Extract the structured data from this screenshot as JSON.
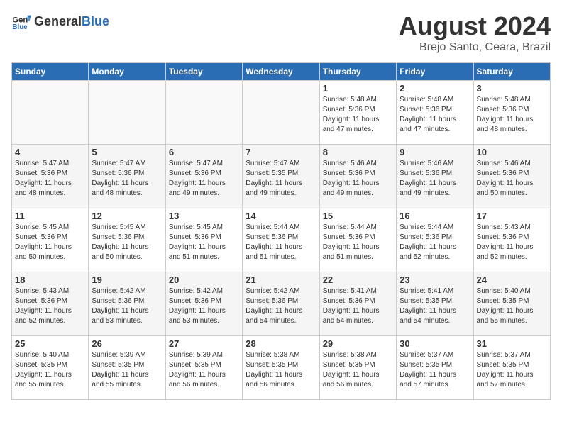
{
  "header": {
    "logo_general": "General",
    "logo_blue": "Blue",
    "month": "August 2024",
    "location": "Brejo Santo, Ceara, Brazil"
  },
  "calendar": {
    "days_of_week": [
      "Sunday",
      "Monday",
      "Tuesday",
      "Wednesday",
      "Thursday",
      "Friday",
      "Saturday"
    ],
    "weeks": [
      {
        "rowClass": "row-odd",
        "days": [
          {
            "num": "",
            "info": "",
            "empty": true
          },
          {
            "num": "",
            "info": "",
            "empty": true
          },
          {
            "num": "",
            "info": "",
            "empty": true
          },
          {
            "num": "",
            "info": "",
            "empty": true
          },
          {
            "num": "1",
            "info": "Sunrise: 5:48 AM\nSunset: 5:36 PM\nDaylight: 11 hours\nand 47 minutes.",
            "empty": false
          },
          {
            "num": "2",
            "info": "Sunrise: 5:48 AM\nSunset: 5:36 PM\nDaylight: 11 hours\nand 47 minutes.",
            "empty": false
          },
          {
            "num": "3",
            "info": "Sunrise: 5:48 AM\nSunset: 5:36 PM\nDaylight: 11 hours\nand 48 minutes.",
            "empty": false
          }
        ]
      },
      {
        "rowClass": "row-even",
        "days": [
          {
            "num": "4",
            "info": "Sunrise: 5:47 AM\nSunset: 5:36 PM\nDaylight: 11 hours\nand 48 minutes.",
            "empty": false
          },
          {
            "num": "5",
            "info": "Sunrise: 5:47 AM\nSunset: 5:36 PM\nDaylight: 11 hours\nand 48 minutes.",
            "empty": false
          },
          {
            "num": "6",
            "info": "Sunrise: 5:47 AM\nSunset: 5:36 PM\nDaylight: 11 hours\nand 49 minutes.",
            "empty": false
          },
          {
            "num": "7",
            "info": "Sunrise: 5:47 AM\nSunset: 5:35 PM\nDaylight: 11 hours\nand 49 minutes.",
            "empty": false
          },
          {
            "num": "8",
            "info": "Sunrise: 5:46 AM\nSunset: 5:36 PM\nDaylight: 11 hours\nand 49 minutes.",
            "empty": false
          },
          {
            "num": "9",
            "info": "Sunrise: 5:46 AM\nSunset: 5:36 PM\nDaylight: 11 hours\nand 49 minutes.",
            "empty": false
          },
          {
            "num": "10",
            "info": "Sunrise: 5:46 AM\nSunset: 5:36 PM\nDaylight: 11 hours\nand 50 minutes.",
            "empty": false
          }
        ]
      },
      {
        "rowClass": "row-odd",
        "days": [
          {
            "num": "11",
            "info": "Sunrise: 5:45 AM\nSunset: 5:36 PM\nDaylight: 11 hours\nand 50 minutes.",
            "empty": false
          },
          {
            "num": "12",
            "info": "Sunrise: 5:45 AM\nSunset: 5:36 PM\nDaylight: 11 hours\nand 50 minutes.",
            "empty": false
          },
          {
            "num": "13",
            "info": "Sunrise: 5:45 AM\nSunset: 5:36 PM\nDaylight: 11 hours\nand 51 minutes.",
            "empty": false
          },
          {
            "num": "14",
            "info": "Sunrise: 5:44 AM\nSunset: 5:36 PM\nDaylight: 11 hours\nand 51 minutes.",
            "empty": false
          },
          {
            "num": "15",
            "info": "Sunrise: 5:44 AM\nSunset: 5:36 PM\nDaylight: 11 hours\nand 51 minutes.",
            "empty": false
          },
          {
            "num": "16",
            "info": "Sunrise: 5:44 AM\nSunset: 5:36 PM\nDaylight: 11 hours\nand 52 minutes.",
            "empty": false
          },
          {
            "num": "17",
            "info": "Sunrise: 5:43 AM\nSunset: 5:36 PM\nDaylight: 11 hours\nand 52 minutes.",
            "empty": false
          }
        ]
      },
      {
        "rowClass": "row-even",
        "days": [
          {
            "num": "18",
            "info": "Sunrise: 5:43 AM\nSunset: 5:36 PM\nDaylight: 11 hours\nand 52 minutes.",
            "empty": false
          },
          {
            "num": "19",
            "info": "Sunrise: 5:42 AM\nSunset: 5:36 PM\nDaylight: 11 hours\nand 53 minutes.",
            "empty": false
          },
          {
            "num": "20",
            "info": "Sunrise: 5:42 AM\nSunset: 5:36 PM\nDaylight: 11 hours\nand 53 minutes.",
            "empty": false
          },
          {
            "num": "21",
            "info": "Sunrise: 5:42 AM\nSunset: 5:36 PM\nDaylight: 11 hours\nand 54 minutes.",
            "empty": false
          },
          {
            "num": "22",
            "info": "Sunrise: 5:41 AM\nSunset: 5:36 PM\nDaylight: 11 hours\nand 54 minutes.",
            "empty": false
          },
          {
            "num": "23",
            "info": "Sunrise: 5:41 AM\nSunset: 5:35 PM\nDaylight: 11 hours\nand 54 minutes.",
            "empty": false
          },
          {
            "num": "24",
            "info": "Sunrise: 5:40 AM\nSunset: 5:35 PM\nDaylight: 11 hours\nand 55 minutes.",
            "empty": false
          }
        ]
      },
      {
        "rowClass": "row-odd",
        "days": [
          {
            "num": "25",
            "info": "Sunrise: 5:40 AM\nSunset: 5:35 PM\nDaylight: 11 hours\nand 55 minutes.",
            "empty": false
          },
          {
            "num": "26",
            "info": "Sunrise: 5:39 AM\nSunset: 5:35 PM\nDaylight: 11 hours\nand 55 minutes.",
            "empty": false
          },
          {
            "num": "27",
            "info": "Sunrise: 5:39 AM\nSunset: 5:35 PM\nDaylight: 11 hours\nand 56 minutes.",
            "empty": false
          },
          {
            "num": "28",
            "info": "Sunrise: 5:38 AM\nSunset: 5:35 PM\nDaylight: 11 hours\nand 56 minutes.",
            "empty": false
          },
          {
            "num": "29",
            "info": "Sunrise: 5:38 AM\nSunset: 5:35 PM\nDaylight: 11 hours\nand 56 minutes.",
            "empty": false
          },
          {
            "num": "30",
            "info": "Sunrise: 5:37 AM\nSunset: 5:35 PM\nDaylight: 11 hours\nand 57 minutes.",
            "empty": false
          },
          {
            "num": "31",
            "info": "Sunrise: 5:37 AM\nSunset: 5:35 PM\nDaylight: 11 hours\nand 57 minutes.",
            "empty": false
          }
        ]
      }
    ]
  }
}
